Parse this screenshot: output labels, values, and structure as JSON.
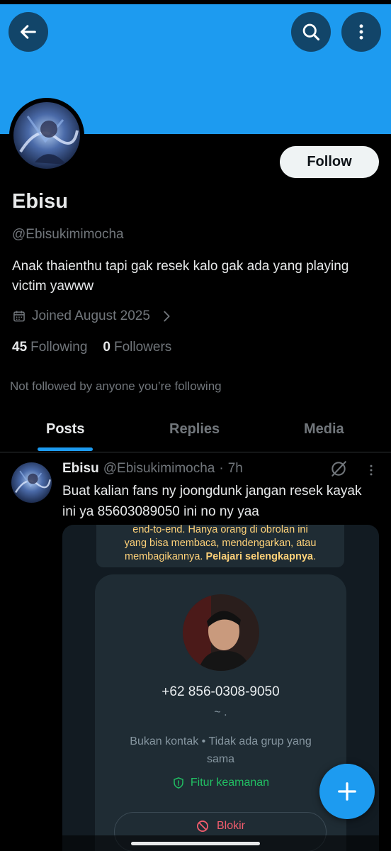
{
  "colors": {
    "accent": "#1d9bf0",
    "background": "#000000",
    "text_primary": "#e7e9ea",
    "text_secondary": "#71767b",
    "whatsapp_green": "#21c063",
    "whatsapp_red": "#f15c6d",
    "whatsapp_yellow": "#ffd279"
  },
  "header": {
    "back_icon": "arrow-left-icon",
    "search_icon": "search-icon",
    "more_icon": "more-vertical-icon"
  },
  "profile": {
    "follow_label": "Follow",
    "name": "Ebisu",
    "handle": "@Ebisukimimocha",
    "bio": "Anak thaienthu tapi gak resek kalo gak ada yang playing victim yawww",
    "joined": "Joined August 2025",
    "following_count": "45",
    "following_label": "Following",
    "followers_count": "0",
    "followers_label": "Followers",
    "not_followed_note": "Not followed by anyone you’re following"
  },
  "tabs": [
    {
      "label": "Posts",
      "active": true
    },
    {
      "label": "Replies",
      "active": false
    },
    {
      "label": "Media",
      "active": false
    }
  ],
  "post": {
    "name": "Ebisu",
    "handle": "@Ebisukimimocha",
    "separator": "·",
    "time": "7h",
    "text": "Buat kalian fans ny joongdunk jangan resek kayak ini ya 85603089050 ini no ny yaa",
    "media": {
      "encryption_line1": "end-to-end. Hanya orang di obrolan ini",
      "encryption_line2": "yang bisa membaca, mendengarkan, atau",
      "encryption_line3": "membagikannya.",
      "learn_more": "Pelajari selengkapnya",
      "learn_more_suffix": ".",
      "phone": "+62 856-0308-9050",
      "tilde": "~ .",
      "not_contact": "Bukan kontak • Tidak ada grup yang sama",
      "security_label": "Fitur keamanan",
      "block_label": "Blokir"
    }
  },
  "fab": {
    "icon": "plus-icon"
  }
}
